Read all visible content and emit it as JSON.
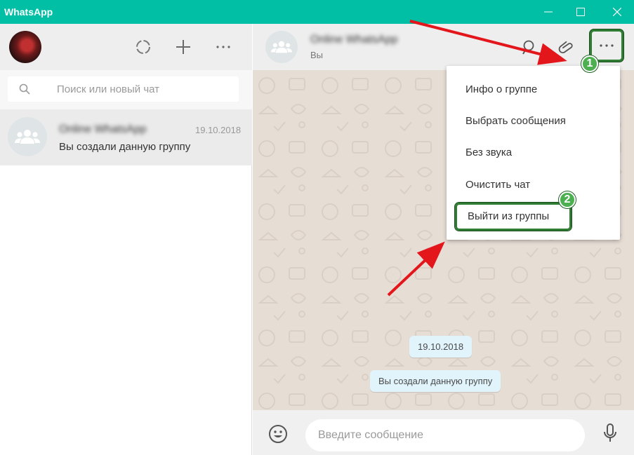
{
  "window": {
    "title": "WhatsApp"
  },
  "sidebar": {
    "search_placeholder": "Поиск или новый чат",
    "chats": [
      {
        "name": "Online WhatsApp",
        "date": "19.10.2018",
        "last_message": "Вы создали данную группу"
      }
    ]
  },
  "conversation": {
    "title": "Online WhatsApp",
    "subtitle": "Вы",
    "messages": [
      {
        "type": "date",
        "text": "19.10.2018"
      },
      {
        "type": "system",
        "text": "Вы создали данную группу"
      }
    ],
    "input_placeholder": "Введите сообщение"
  },
  "menu": {
    "items": [
      "Инфо о группе",
      "Выбрать сообщения",
      "Без звука",
      "Очистить чат",
      "Выйти из группы"
    ]
  },
  "annotations": {
    "badge_1": "1",
    "badge_2": "2"
  },
  "colors": {
    "titlebar": "#00bfa5",
    "highlight": "#2e7d32",
    "arrow": "#e3161c",
    "chat_bg": "#e6ddd4"
  }
}
